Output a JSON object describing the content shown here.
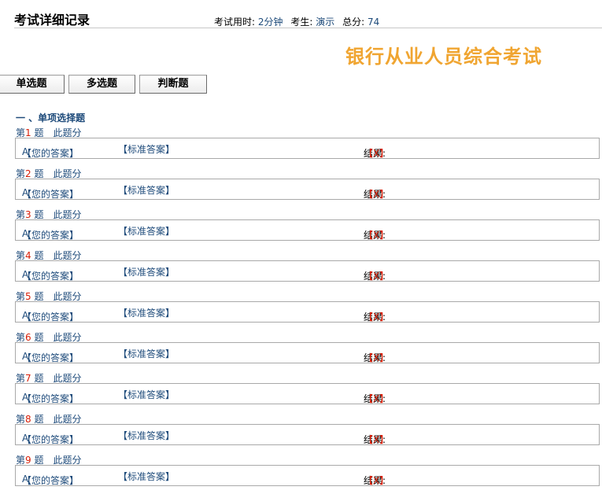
{
  "header": {
    "title": "考试详细记录",
    "time_label": "考试用时:",
    "time_value": "2分钟",
    "examinee_label": "考生:",
    "examinee_value": "演示",
    "score_label": "总分:",
    "score_value": "74"
  },
  "exam_name": "银行从业人员综合考试",
  "tabs": [
    {
      "label": "单选题"
    },
    {
      "label": "多选题"
    },
    {
      "label": "判断题"
    }
  ],
  "section_title": "一 、单项选择题",
  "question_prefix": "第",
  "question_suffix": " 题",
  "score_text": "此题分",
  "your_answer_label": "【您的答案】",
  "standard_answer_label": "【标准答案】",
  "result_label": "结果:",
  "questions": [
    {
      "num": "1",
      "your_answer": "A",
      "result": "【X】"
    },
    {
      "num": "2",
      "your_answer": "A",
      "result": "【X】"
    },
    {
      "num": "3",
      "your_answer": "A",
      "result": "【X】"
    },
    {
      "num": "4",
      "your_answer": "A",
      "result": "【X】"
    },
    {
      "num": "5",
      "your_answer": "A",
      "result": "【X】"
    },
    {
      "num": "6",
      "your_answer": "A",
      "result": "【X】"
    },
    {
      "num": "7",
      "your_answer": "A",
      "result": "【X】"
    },
    {
      "num": "8",
      "your_answer": "A",
      "result": "【X】"
    },
    {
      "num": "9",
      "your_answer": "A",
      "result": "【X】"
    }
  ],
  "colors": {
    "exam_name": "#f0a531",
    "link_blue": "#1d4a7a",
    "wrong_red": "#d81e06"
  }
}
